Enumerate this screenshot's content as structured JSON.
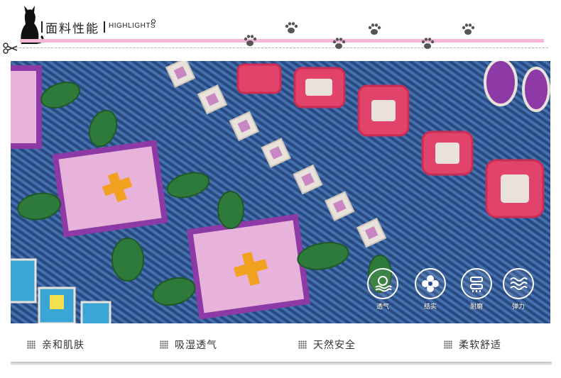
{
  "header": {
    "title_cn": "面料性能",
    "title_en": "HIGHLIGHTS"
  },
  "features": [
    {
      "label": "透气",
      "icon": "breathable-icon"
    },
    {
      "label": "结实",
      "icon": "sturdy-icon"
    },
    {
      "label": "耐磨",
      "icon": "wear-resistant-icon"
    },
    {
      "label": "弹力",
      "icon": "elastic-icon"
    }
  ],
  "bottom_items": [
    {
      "label": "亲和肌肤"
    },
    {
      "label": "吸湿透气"
    },
    {
      "label": "天然安全"
    },
    {
      "label": "柔软舒适"
    }
  ],
  "colors": {
    "pink_line": "#f4b8d6",
    "denim": "#2b4d86",
    "embroidery_pink": "#e2436a",
    "embroidery_purple": "#8e3aa6",
    "embroidery_orange": "#f2a020",
    "leaf_green": "#2e7a3a"
  }
}
